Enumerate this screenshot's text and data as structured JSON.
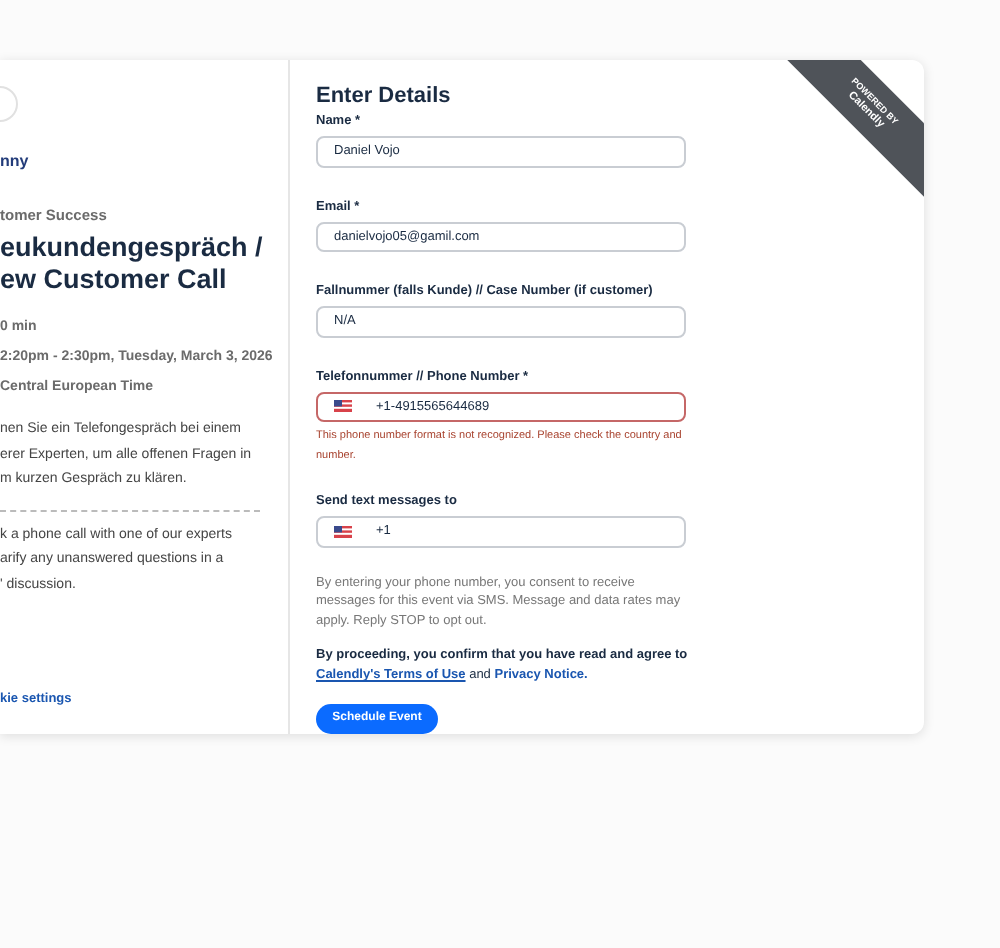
{
  "sidebar": {
    "logo": "nny",
    "category": "tomer Success",
    "title_lines": [
      "eukundengespräch /",
      "ew Customer Call"
    ],
    "details": [
      "0 min",
      "2:20pm - 2:30pm, Tuesday, March 3, 2026",
      "Central European Time"
    ],
    "description_de": [
      "nen Sie ein Telefongespräch bei einem",
      "erer Experten, um alle offenen Fragen in",
      "m kurzen Gespräch zu klären."
    ],
    "description_en": [
      "k a phone call with one of our experts",
      "arify any unanswered questions in a",
      "' discussion."
    ],
    "cookie_link": "kie settings"
  },
  "ribbon": {
    "top": "POWERED BY",
    "brand": "Calendly"
  },
  "form": {
    "title": "Enter Details",
    "fields": [
      {
        "kind": "text",
        "label": "Name *",
        "value": "Daniel Vojo",
        "invalid": false
      },
      {
        "kind": "text",
        "label": "Email *",
        "value": "danielvojo05@gamil.com",
        "invalid": false
      },
      {
        "kind": "text",
        "label": "Fallnummer (falls Kunde) // Case Number (if customer)",
        "value": "N/A",
        "invalid": false
      },
      {
        "kind": "phone",
        "label": "Telefonnummer // Phone Number *",
        "value": "+1-4915565644689",
        "invalid": true,
        "error": "This phone number format is not recognized. Please check the country and number."
      },
      {
        "kind": "phone",
        "label": "Send text messages to",
        "value": "+1",
        "invalid": false
      }
    ],
    "consent": "By entering your phone number, you consent to receive messages for this event via SMS. Message and data rates may apply. Reply STOP to opt out.",
    "terms": {
      "before": "By proceeding, you confirm that you have read and agree to",
      "link1": "Calendly's Terms of Use",
      "middle": "and",
      "link2": "Privacy Notice."
    },
    "submit": "Schedule Event"
  }
}
